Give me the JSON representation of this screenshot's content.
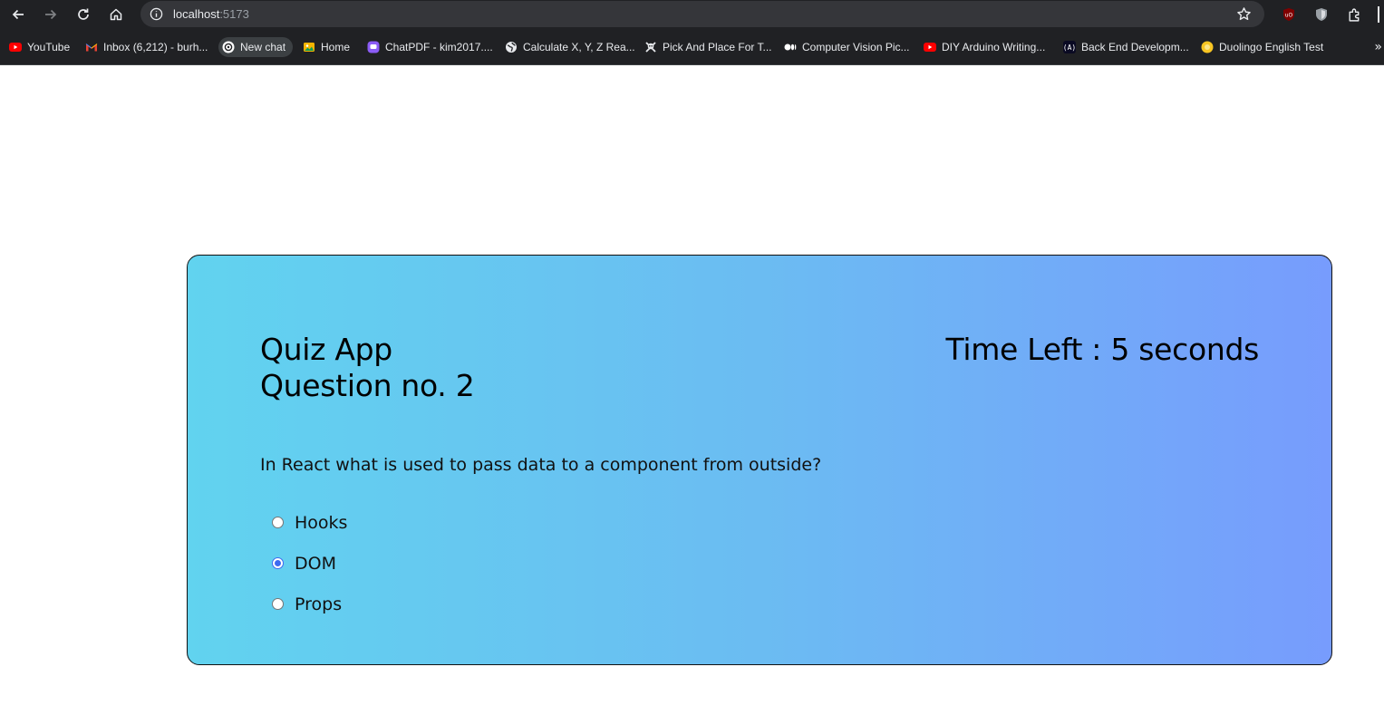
{
  "browser": {
    "url_host": "localhost",
    "url_port": ":5173",
    "bookmarks": [
      {
        "label": "YouTube",
        "icon": "youtube-icon",
        "color": "#ff0000"
      },
      {
        "label": "Inbox (6,212) - burh...",
        "icon": "gmail-icon",
        "color": "#ea4335"
      },
      {
        "label": "New chat",
        "icon": "openai-icon",
        "color": "#ffffff"
      },
      {
        "label": "Home",
        "icon": "home-photo-icon",
        "color": "#f4b400"
      },
      {
        "label": "ChatPDF - kim2017....",
        "icon": "chatpdf-icon",
        "color": "#8b5cf6"
      },
      {
        "label": "Calculate X, Y, Z Rea...",
        "icon": "globe-icon",
        "color": "#e8eaed"
      },
      {
        "label": "Pick And Place For T...",
        "icon": "skull-icon",
        "color": "#e8eaed"
      },
      {
        "label": "Computer Vision Pic...",
        "icon": "medium-icon",
        "color": "#ffffff"
      },
      {
        "label": "DIY Arduino Writing...",
        "icon": "youtube-icon",
        "color": "#ff0000"
      },
      {
        "label": "Back End Developm...",
        "icon": "freecodecamp-icon",
        "color": "#0a0a23"
      },
      {
        "label": "Duolingo English Test",
        "icon": "duolingo-icon",
        "color": "#f9c623"
      }
    ],
    "more_bookmarks": "»"
  },
  "quiz": {
    "app_title": "Quiz App",
    "question_number": "Question no. 2",
    "timer_text": "Time Left : 5 seconds",
    "question": "In React what is used to pass data to a component from outside?",
    "options": [
      {
        "label": "Hooks",
        "selected": false
      },
      {
        "label": "DOM",
        "selected": true
      },
      {
        "label": "Props",
        "selected": false
      }
    ],
    "gradient_start": "#61d3ef",
    "gradient_end": "#779cfd"
  }
}
